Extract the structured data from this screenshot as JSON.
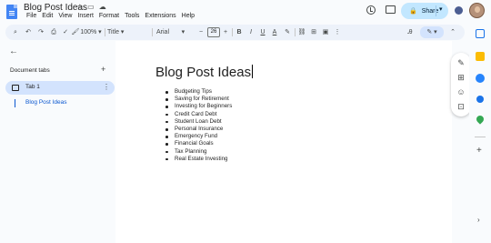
{
  "doc": {
    "title": "Blog Post Ideas",
    "heading": "Blog Post Ideas",
    "list_items": [
      "Budgeting Tips",
      "Saving for Retirement",
      "Investing for Beginners",
      "Credit Card Debt",
      "Student Loan Debt",
      "Personal Insurance",
      "Emergency Fund",
      "Financial Goals",
      "Tax Planning",
      "Real Estate Investing"
    ]
  },
  "menu": [
    "File",
    "Edit",
    "View",
    "Insert",
    "Format",
    "Tools",
    "Extensions",
    "Help"
  ],
  "share": {
    "label": "Share"
  },
  "toolbar": {
    "zoom": "100%",
    "style": "Title",
    "font": "Arial",
    "font_size": "26",
    "bold": "B",
    "italic": "I",
    "underline": "U",
    "text_color": "A",
    "minus": "−",
    "plus": "+"
  },
  "sidebar": {
    "heading": "Document tabs",
    "tab_label": "Tab 1",
    "outline_item": "Blog Post Ideas"
  },
  "colors": {
    "accent": "#0b57d0",
    "share_bg": "#c2e7ff",
    "tab_selected_bg": "#d3e3fd",
    "toolbar_bg": "#edf2fa"
  },
  "icons": {
    "star": "star-icon",
    "folder": "move-folder-icon",
    "cloud": "cloud-status-icon",
    "history": "history-icon",
    "comment": "comment-icon",
    "lock": "lock-icon",
    "search": "search-icon",
    "undo": "undo-icon",
    "redo": "redo-icon",
    "print": "print-icon",
    "paint_format": "paint-format-icon"
  }
}
